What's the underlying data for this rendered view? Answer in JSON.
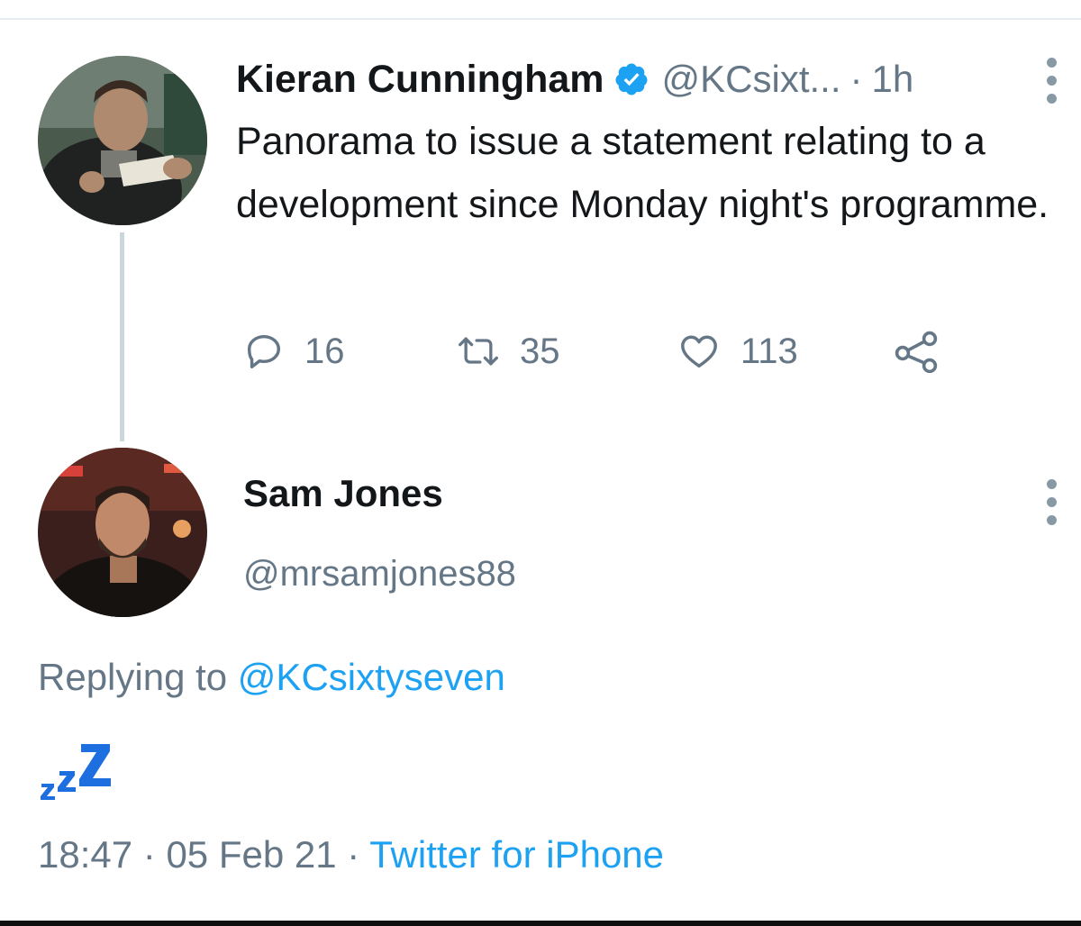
{
  "tweet": {
    "author_name": "Kieran Cunningham",
    "author_handle": "@KCsixt...",
    "separator": "·",
    "time_ago": "1h",
    "text": "Panorama to issue a statement relating to a development since Monday night's programme.",
    "reply_count": "16",
    "retweet_count": "35",
    "like_count": "113",
    "verified_badge_icon": "verified-badge-icon",
    "accent_color": "#1da1f2"
  },
  "reply": {
    "author_name": "Sam Jones",
    "author_handle": "@mrsamjones88",
    "replying_prefix": "Replying to",
    "replying_to": "@KCsixtyseven",
    "content_icon": "zzz-sleeping-emoji",
    "time": "18:47",
    "separator": "·",
    "date": "05 Feb 21",
    "source": "Twitter for iPhone"
  },
  "colors": {
    "link": "#1da1f2",
    "secondary_text": "#657786",
    "primary_text": "#14171a",
    "thread_line": "#ccd6dd"
  }
}
